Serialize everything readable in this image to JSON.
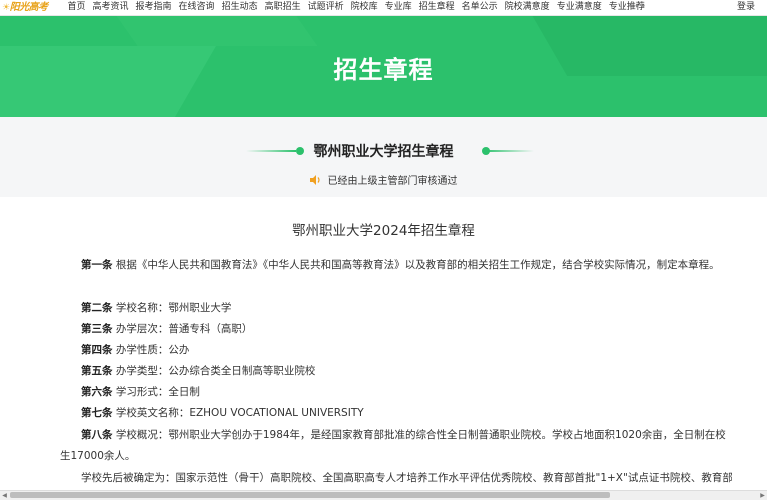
{
  "logo": {
    "text": "阳光高考"
  },
  "nav": {
    "items": [
      "首页",
      "高考资讯",
      "报考指南",
      "在线咨询",
      "招生动态",
      "高职招生",
      "试题评析",
      "院校库",
      "专业库",
      "招生章程",
      "名单公示",
      "院校满意度",
      "专业满意度",
      "专业推荐"
    ],
    "more": "•••",
    "login": "登录"
  },
  "banner": {
    "title": "招生章程"
  },
  "subhead": {
    "school_title": "鄂州职业大学招生章程",
    "notice": "已经由上级主管部门审核通过"
  },
  "article": {
    "title": "鄂州职业大学2024年招生章程",
    "paragraphs": [
      {
        "label": "第一条",
        "text": " 根据《中华人民共和国教育法》《中华人民共和国高等教育法》以及教育部的相关招生工作规定，结合学校实际情况，制定本章程。"
      },
      {
        "label": "第二条",
        "text": " 学校名称：鄂州职业大学"
      },
      {
        "label": "第三条",
        "text": " 办学层次：普通专科（高职）"
      },
      {
        "label": "第四条",
        "text": " 办学性质：公办"
      },
      {
        "label": "第五条",
        "text": " 办学类型：公办综合类全日制高等职业院校"
      },
      {
        "label": "第六条",
        "text": " 学习形式：全日制"
      },
      {
        "label": "第七条",
        "text": " 学校英文名称：EZHOU VOCATIONAL UNIVERSITY"
      },
      {
        "label": "第八条",
        "text": " 学校概况：鄂州职业大学创办于1984年，是经国家教育部批准的综合性全日制普通职业院校。学校占地面积1020余亩，全日制在校生17000余人。"
      },
      {
        "label": "",
        "text": "学校先后被确定为：国家示范性（骨干）高职院校、全国高职高专人才培养工作水平评估优秀院校、教育部首批\"1+X\"试点证书院校、教育部"
      }
    ]
  },
  "colors": {
    "brand_green": "#2cc16c",
    "logo_orange": "#e8a21a"
  }
}
